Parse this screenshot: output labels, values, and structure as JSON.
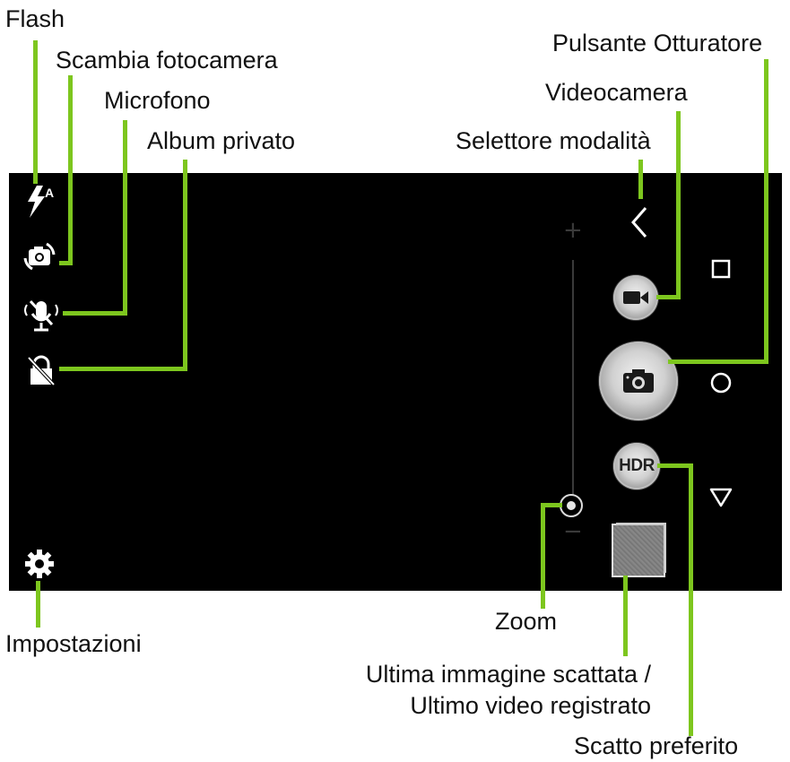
{
  "annotations": {
    "flash": "Flash",
    "switch_camera": "Scambia fotocamera",
    "microphone": "Microfono",
    "private_album": "Album privato",
    "shutter_button": "Pulsante Otturatore",
    "videocamera": "Videocamera",
    "mode_selector": "Selettore modalità",
    "zoom": "Zoom",
    "settings": "Impostazioni",
    "last_image_line1": "Ultima immagine scattata /",
    "last_image_line2": "Ultimo video registrato",
    "favorite_shot": "Scatto preferito"
  },
  "camera": {
    "flash_mode": "A",
    "hdr_label": "HDR",
    "zoom_plus": "+",
    "zoom_minus": "−"
  },
  "colors": {
    "leader_line": "#7dc61e",
    "screen_bg": "#000000"
  },
  "icons": [
    "flash-auto-icon",
    "switch-camera-icon",
    "microphone-muted-icon",
    "private-album-icon",
    "settings-gear-icon",
    "back-chevron-icon",
    "video-camera-icon",
    "camera-icon",
    "nav-square-icon",
    "nav-circle-icon",
    "nav-triangle-icon"
  ]
}
